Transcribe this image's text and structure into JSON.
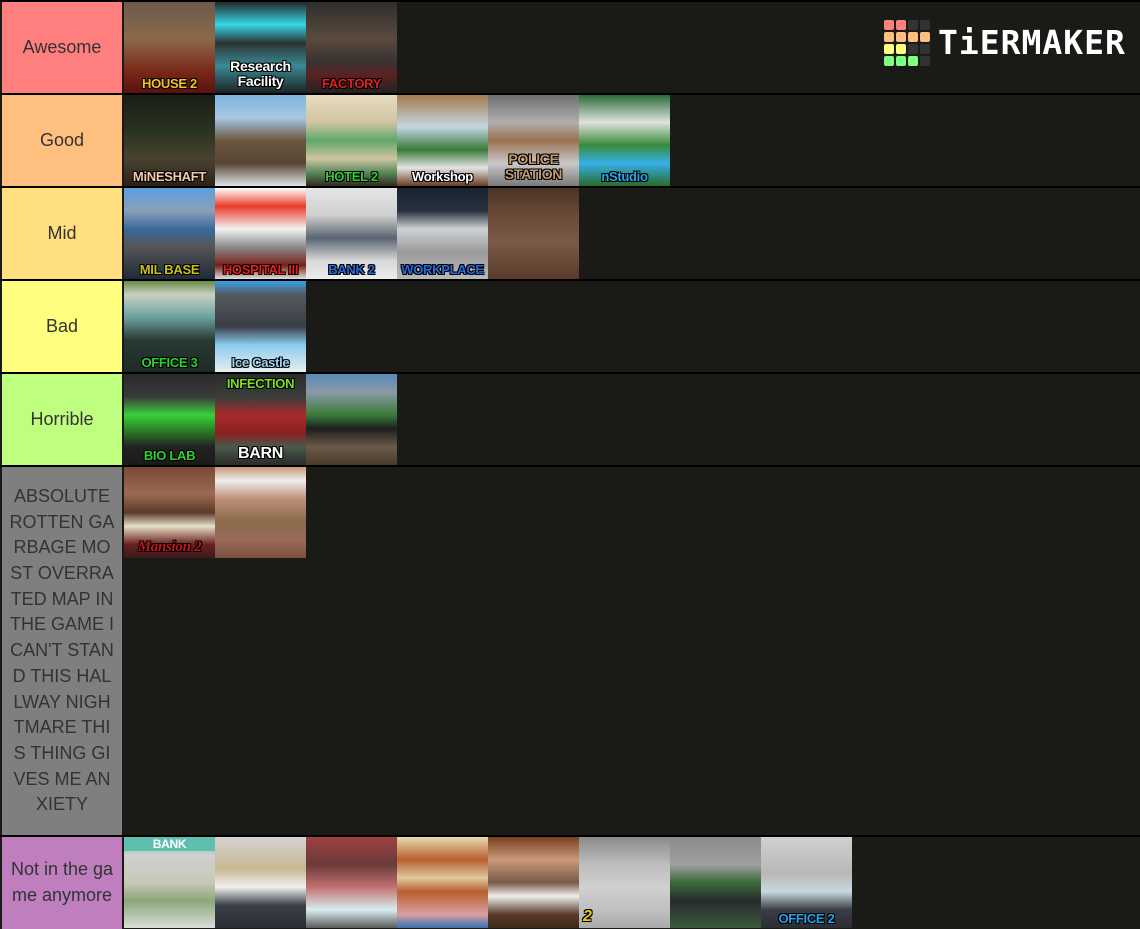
{
  "brand": {
    "name": "TiERMAKER",
    "grid_colors": [
      "#ff7f7f",
      "#ff7f7f",
      "#333333",
      "#333333",
      "#ffbf7f",
      "#ffbf7f",
      "#ffbf7f",
      "#ffbf7f",
      "#ffff7f",
      "#ffff7f",
      "#333333",
      "#333333",
      "#7fff7f",
      "#7fff7f",
      "#7fff7f",
      "#333333"
    ]
  },
  "tiers": [
    {
      "label": "Awesome",
      "color": "#ff7f7f",
      "items": [
        {
          "caption": "HOUSE 2",
          "caption_color": "#f7c41f",
          "bg": "linear-gradient(180deg,#6b5a4a 0%,#8a6a4a 40%,#7a2a1a 75%,#5a1010 100%)"
        },
        {
          "caption": "Research Facility",
          "caption_color": "#ffffff",
          "bg": "linear-gradient(180deg,#202a2a 0%,#39d6e6 25%,#2b3333 45%,#3a8a95 70%,#1b2222 100%)"
        },
        {
          "caption": "FACTORY",
          "caption_color": "#e02020",
          "bg": "linear-gradient(180deg,#2e2e2e 0%,#5a4a3e 40%,#3a3333 65%,#5a2222 80%,#222 100%)"
        }
      ]
    },
    {
      "label": "Good",
      "color": "#ffbf7f",
      "items": [
        {
          "caption": "MiNESHAFT",
          "caption_color": "#f6c9a9",
          "bg": "linear-gradient(180deg,#1a1f15 0%,#2a3322 40%,#4a4230 70%,#2a2218 100%)"
        },
        {
          "caption": "",
          "caption_color": "#ffffff",
          "bg": "linear-gradient(180deg,#7fb4e0 0%,#a7c8e2 25%,#6b5740 50%,#564533 75%,#dfe3e6 100%)"
        },
        {
          "caption": "HOTEL 2",
          "caption_color": "#33cc33",
          "bg": "linear-gradient(180deg,#e8dcc0 0%,#cfc4a3 30%,#5fa86a 50%,#cfc4a3 70%,#5a8a5a 85%,#302a20 100%)"
        },
        {
          "caption": "Workshop",
          "caption_color": "#ffffff",
          "bg": "linear-gradient(180deg,#a27a4e 0%,#c4d7e3 35%,#3a7a3a 60%,#e4e4e4 80%,#6a3a22 100%)"
        },
        {
          "caption": "POLICE STATION",
          "caption_color": "#c49a6c",
          "bg": "linear-gradient(180deg,#6f6f6f 0%,#b0b0b0 30%,#9a7050 50%,#c9c9c9 75%,#7a7a7a 100%)"
        },
        {
          "caption": "nStudio",
          "caption_color": "#2aa8e8",
          "bg": "linear-gradient(180deg,#2c6a3a 0%,#dfe3de 30%,#3a8a3a 55%,#35b0e8 75%,#2a6a2a 100%)"
        }
      ]
    },
    {
      "label": "Mid",
      "color": "#ffdf7f",
      "items": [
        {
          "caption": "MIL BASE",
          "caption_color": "#c9c21a",
          "bg": "linear-gradient(180deg,#5aa0e0 0%,#8aa0b8 25%,#3a6a9a 45%,#555 65%,#1e2a38 100%)"
        },
        {
          "caption": "HOSPITAL III",
          "caption_color": "#e02020",
          "bg": "linear-gradient(180deg,#ffffff 0%,#e93b2a 20%,#f3f3f3 45%,#8a8a8a 65%,#7a2018 85%,#e0e0e0 100%)"
        },
        {
          "caption": "BANK 2",
          "caption_color": "#2a6ad8",
          "bg": "linear-gradient(180deg,#e6e6e6 0%,#cfcfcf 30%,#5a6470 55%,#d8d8d8 80%,#ececec 100%)"
        },
        {
          "caption": "WORKPLACE",
          "caption_color": "#2a6ad8",
          "bg": "linear-gradient(180deg,#1a2230 0%,#27313f 25%,#cfd2d5 45%,#9a9a9a 70%,#b8b8b8 100%)"
        },
        {
          "caption": "",
          "caption_color": "#ffffff",
          "bg": "linear-gradient(180deg,#4a3326 0%,#6a4a36 30%,#7a5a46 60%,#5a3a2a 100%)"
        }
      ]
    },
    {
      "label": "Bad",
      "color": "#ffff7f",
      "items": [
        {
          "caption": "OFFICE 3",
          "caption_color": "#2ed12e",
          "bg": "linear-gradient(180deg,#6a8a4a 0%,#c8d2c0 15%,#6aa0a0 40%,#2a3a33 65%,#1e2a25 100%)"
        },
        {
          "caption": "Ice Castle",
          "caption_color": "#9ad6f3",
          "bg": "linear-gradient(180deg,#3aa0e8 0%,#555a5f 15%,#3a3e44 50%,#8acbec 70%,#e8eef2 100%)"
        }
      ]
    },
    {
      "label": "Horrible",
      "color": "#bfff7f",
      "items": [
        {
          "caption": "BIO LAB",
          "caption_color": "#2ed12e",
          "bg": "linear-gradient(180deg,#2a2a2a 0%,#3a3a3a 25%,#3ad13a 45%,#2a8a2a 60%,#222 80%,#1a1a1a 100%)"
        },
        {
          "caption": "INFECTION",
          "caption_top": true,
          "caption2": "BARN",
          "caption_color": "#7fe01f",
          "caption2_color": "#ffffff",
          "bg": "linear-gradient(180deg,#2a2e2a 0%,#3a3e3a 25%,#a82a2a 45%,#8a2020 65%,#4a5a4a 80%,#2a2a2a 100%)"
        },
        {
          "caption": "",
          "caption_color": "#ffffff",
          "bg": "linear-gradient(180deg,#5a8ab8 0%,#8a9aa8 20%,#3a7a3a 45%,#1e1e1e 60%,#6a5a4a 80%,#4a3a2a 100%)"
        }
      ]
    },
    {
      "label": "ABSOLUTE ROTTEN GARBAGE MOST OVERRATED MAP IN THE GAME I CAN'T STAND THIS HALLWAY NIGHTMARE THIS THING GIVES ME ANXIETY",
      "color": "#7f7f7f",
      "items": [
        {
          "caption": "Mansion 2",
          "caption_color": "#c01818",
          "italic": true,
          "bg": "linear-gradient(180deg,#7a4a3a 0%,#9a6a50 30%,#5a3a2a 50%,#e6dfc8 65%,#6a2020 85%,#3a1a1a 100%)"
        },
        {
          "caption": "",
          "caption_color": "#ffffff",
          "bg": "linear-gradient(180deg,#c89a7a 0%,#eee 15%,#c0907a 35%,#8a6a4a 60%,#9a6a5a 80%,#7a5040 100%)"
        }
      ]
    },
    {
      "label": "Not in the game anymore",
      "color": "#bf7fbf",
      "items": [
        {
          "caption": "BANK",
          "caption_top": true,
          "caption_color": "#ffffff",
          "caption_bg": "#5fbfaf",
          "bg": "linear-gradient(180deg,#5fbfaf 0%,#d0d0d0 20%,#c8c8b8 50%,#8aa878 70%,#dcdcdc 100%)"
        },
        {
          "caption": "",
          "caption_color": "#ffffff",
          "bg": "linear-gradient(180deg,#d4d4d4 0%,#c8b890 35%,#f0f0f0 55%,#3a4048 75%,#2a2e33 100%)"
        },
        {
          "caption": "",
          "caption_color": "#ffffff",
          "bg": "linear-gradient(180deg,#a04040 0%,#6a3a3a 30%,#c07070 55%,#d8eef0 80%,#5a5a5a 100%)"
        },
        {
          "caption": "",
          "caption_color": "#ffffff",
          "bg": "linear-gradient(180deg,#e8d8b0 0%,#b86030 25%,#e0c8a0 45%,#b86030 60%,#d8a0a0 85%,#3a70b0 100%)"
        },
        {
          "caption": "",
          "caption_color": "#ffffff",
          "bg": "linear-gradient(180deg,#7a4020 0%,#c89a7a 25%,#7a5a4a 50%,#eeeeee 65%,#5a3a2a 85%,#3a2a1a 100%)"
        },
        {
          "caption": "2",
          "caption_color": "#e8c820",
          "caption_left": true,
          "bg": "linear-gradient(180deg,#8a8a8a 0%,#bdbdbd 30%,#d0d0d0 55%,#c0c0c0 80%,#aaaaaa 100%)"
        },
        {
          "caption": "",
          "caption_color": "#ffffff",
          "bg": "linear-gradient(180deg,#8a8a8a 0%,#a0a0a0 30%,#3a6a3a 50%,#2a2a30 70%,#3a5a3a 100%)"
        },
        {
          "caption": "OFFICE 2",
          "caption_color": "#2aa0e8",
          "bg": "linear-gradient(180deg,#d0d0d0 0%,#b8b8b8 40%,#c8d8e0 60%,#3a3e45 80%,#2a2e33 100%)"
        }
      ]
    }
  ]
}
